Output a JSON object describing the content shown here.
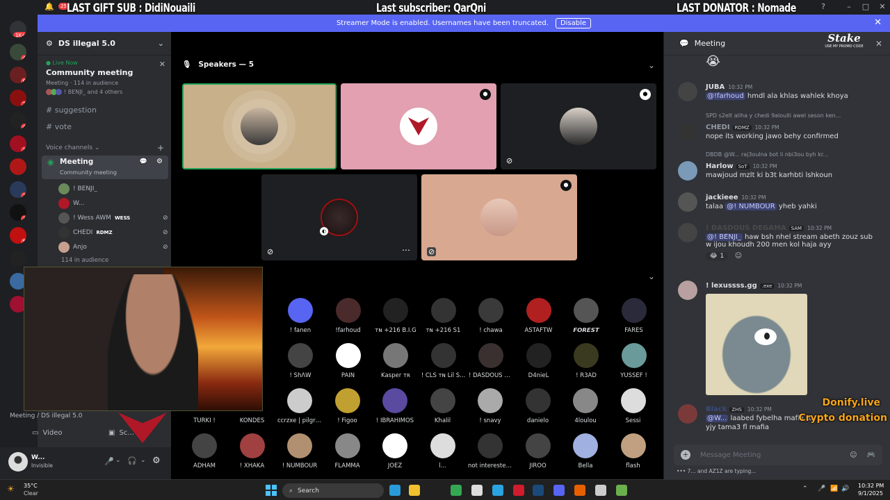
{
  "overlay": {
    "last_gift": "LAST GIFT SUB : DidiNouaili",
    "last_sub": "Last subscriber: QarQni",
    "last_donator": "LAST DONATOR : Nomade",
    "notif_count": "25",
    "donify_line1": "Donify.live",
    "donify_line2": "Crypto donation",
    "stake_brand": "Stake",
    "stake_sub": "USE MY PROMO CODE"
  },
  "banner": {
    "text": "Streamer Mode is enabled. Usernames have been truncated.",
    "button": "Disable"
  },
  "guilds": [
    {
      "badge": "1K+",
      "color": "#313338"
    },
    {
      "badge": "4",
      "color": "#3a4a3a"
    },
    {
      "badge": "6",
      "color": "#6a2020"
    },
    {
      "badge": "2",
      "color": "#8a1010"
    },
    {
      "badge": "4",
      "color": "#222"
    },
    {
      "badge": "1",
      "color": "#a01020"
    },
    {
      "badge": "",
      "color": "#b01818"
    },
    {
      "badge": "2",
      "color": "#2a3a5a"
    },
    {
      "badge": "3",
      "color": "#111"
    },
    {
      "badge": "5",
      "color": "#c01010"
    },
    {
      "badge": "",
      "color": "#222"
    },
    {
      "badge": "",
      "color": "#3a6aa0"
    },
    {
      "badge": "",
      "color": "#a01030"
    }
  ],
  "sidebar": {
    "server_name": "DS illegal 5.0",
    "live_label": "Live Now",
    "event_title": "Community meeting",
    "event_meta": "Meeting · 114 in audience",
    "event_people": "! BENJI_ and 4 others",
    "channels": [
      "suggestion",
      "vote"
    ],
    "voice_header": "Voice channels",
    "voice_channel": "Meeting",
    "voice_sub": "Community meeting",
    "voice_users": [
      "! BENJI_",
      "W...",
      "! Wess AWM",
      "CHEDI",
      "Anjo"
    ],
    "voice_tags": [
      "",
      "",
      "WESS",
      "RDMZ",
      ""
    ],
    "audience_count": "114 in audience",
    "breadcrumb": "Meeting / DS illegal 5.0",
    "video_label": "Video",
    "share_label": "Sc..."
  },
  "userpanel": {
    "name": "W...",
    "status": "Invisible"
  },
  "stage": {
    "speakers_title": "Speakers — 5"
  },
  "audience": [
    {
      "name": "! fanen",
      "color": "#5865f2"
    },
    {
      "name": "!farhoud",
      "color": "#4a2a2a"
    },
    {
      "name": "ᴛɴ +216 B.I.G",
      "color": "#222"
    },
    {
      "name": "ᴛɴ +216 S1",
      "color": "#333"
    },
    {
      "name": "! chawa",
      "color": "#3a3a3a"
    },
    {
      "name": "ASTAFTW",
      "color": "#b02020"
    },
    {
      "name": "𝙁𝙊𝙍𝙀𝙎𝙏",
      "color": "#555"
    },
    {
      "name": "FARES",
      "color": "#2a2a3a"
    },
    {
      "name": "! ShɅW",
      "color": "#444"
    },
    {
      "name": "PAIN",
      "color": "#fff"
    },
    {
      "name": "Kasper ᴛʀ",
      "color": "#777"
    },
    {
      "name": "! CLS ᴛɴ Lil S...",
      "color": "#333"
    },
    {
      "name": "! DASDOUS D...",
      "color": "#3a3030"
    },
    {
      "name": "D4nieL",
      "color": "#222"
    },
    {
      "name": "! R3AD",
      "color": "#3a3a20"
    },
    {
      "name": "YUSSEF !",
      "color": "#6a9a9a"
    },
    {
      "name": "TURKI !",
      "color": "#000"
    },
    {
      "name": "KONDES",
      "color": "#000"
    },
    {
      "name": "ccrzxe | pilgrim",
      "color": "#ccc"
    },
    {
      "name": "! Figoo",
      "color": "#c0a030"
    },
    {
      "name": "! IBRAHIMOS",
      "color": "#5a4aa0"
    },
    {
      "name": "Khalil",
      "color": "#444"
    },
    {
      "name": "! snavy",
      "color": "#aaa"
    },
    {
      "name": "danielo",
      "color": "#333"
    },
    {
      "name": "4loulou",
      "color": "#888"
    },
    {
      "name": "Sessi",
      "color": "#ddd"
    },
    {
      "name": "ADHAM",
      "color": "#444"
    },
    {
      "name": "! XHAKA",
      "color": "#a04040"
    },
    {
      "name": "! NUMBOUR",
      "color": "#b09070"
    },
    {
      "name": "FLAMMA",
      "color": "#888"
    },
    {
      "name": "JOEZ",
      "color": "#fff"
    },
    {
      "name": "l...",
      "color": "#ddd"
    },
    {
      "name": "not interested...",
      "color": "#333"
    },
    {
      "name": "JIROO",
      "color": "#444"
    },
    {
      "name": "Bella",
      "color": "#a0b0e0"
    },
    {
      "name": "flash",
      "color": "#c0a080"
    }
  ],
  "chat": {
    "title": "Meeting",
    "placeholder": "Message Meeting",
    "typing": "7... and AZ1Z are typing...",
    "messages": [
      {
        "user": "JUBA",
        "color": "#f2f3f5",
        "time": "10:32 PM",
        "mention": "@!farhoud",
        "text": "hmdl ala khlas wahlek khoya",
        "reply": ""
      },
      {
        "user": "CHEDI",
        "color": "#f2f3f5",
        "time": "10:32 PM",
        "mention": "",
        "text": "nope its working jawo behy confirmed",
        "reply": "SPD s2elt aliha y chedi 9aloulli awel seson ken..."
      },
      {
        "user": "Harlow",
        "color": "#f2f3f5",
        "time": "10:32 PM",
        "mention": "",
        "text": "mawjoud mzlt ki b3t karhbti lshkoun",
        "reply": "DBDB @W... raj3oulna bot li nbi3ou byh kr..."
      },
      {
        "user": "jackieee",
        "color": "#f2f3f5",
        "time": "10:32 PM",
        "mention": "@! NUMBOUR",
        "text": "talaa yheb yahki",
        "reply": ""
      },
      {
        "user": "! DASDOUS DEGAMA",
        "color": "#f2f3f5",
        "time": "10:32 PM",
        "mention": "@! BENJI_",
        "text": "haw bsh nhel stream abeth zouz sub w ijou khoudh 200 men kol haja ayy",
        "reply": ""
      },
      {
        "user": "! lexussss.gg",
        "color": "#f2f3f5",
        "time": "10:32 PM",
        "mention": "",
        "text": "",
        "reply": ""
      },
      {
        "user": "Black",
        "color": "#f2f3f5",
        "time": "10:32 PM",
        "mention": "@W...",
        "text": "laabed fybelha mafia to",
        "text2": "yjy tama3 fl mafia",
        "reply": ""
      }
    ],
    "tags": [
      "SoT",
      "RDMZ",
      "SAM",
      ".exe",
      "ZHS"
    ],
    "reaction_count": "1"
  },
  "taskbar": {
    "weather_temp": "35°C",
    "weather_desc": "Clear",
    "search": "Search",
    "time": "10:32 PM",
    "date": "9/1/2025"
  },
  "colors": {
    "accent": "#5865f2",
    "live_green": "#23a559",
    "tile1": "#c8b08a",
    "tile2": "#e2a0b0",
    "tile5": "#d8a890"
  }
}
